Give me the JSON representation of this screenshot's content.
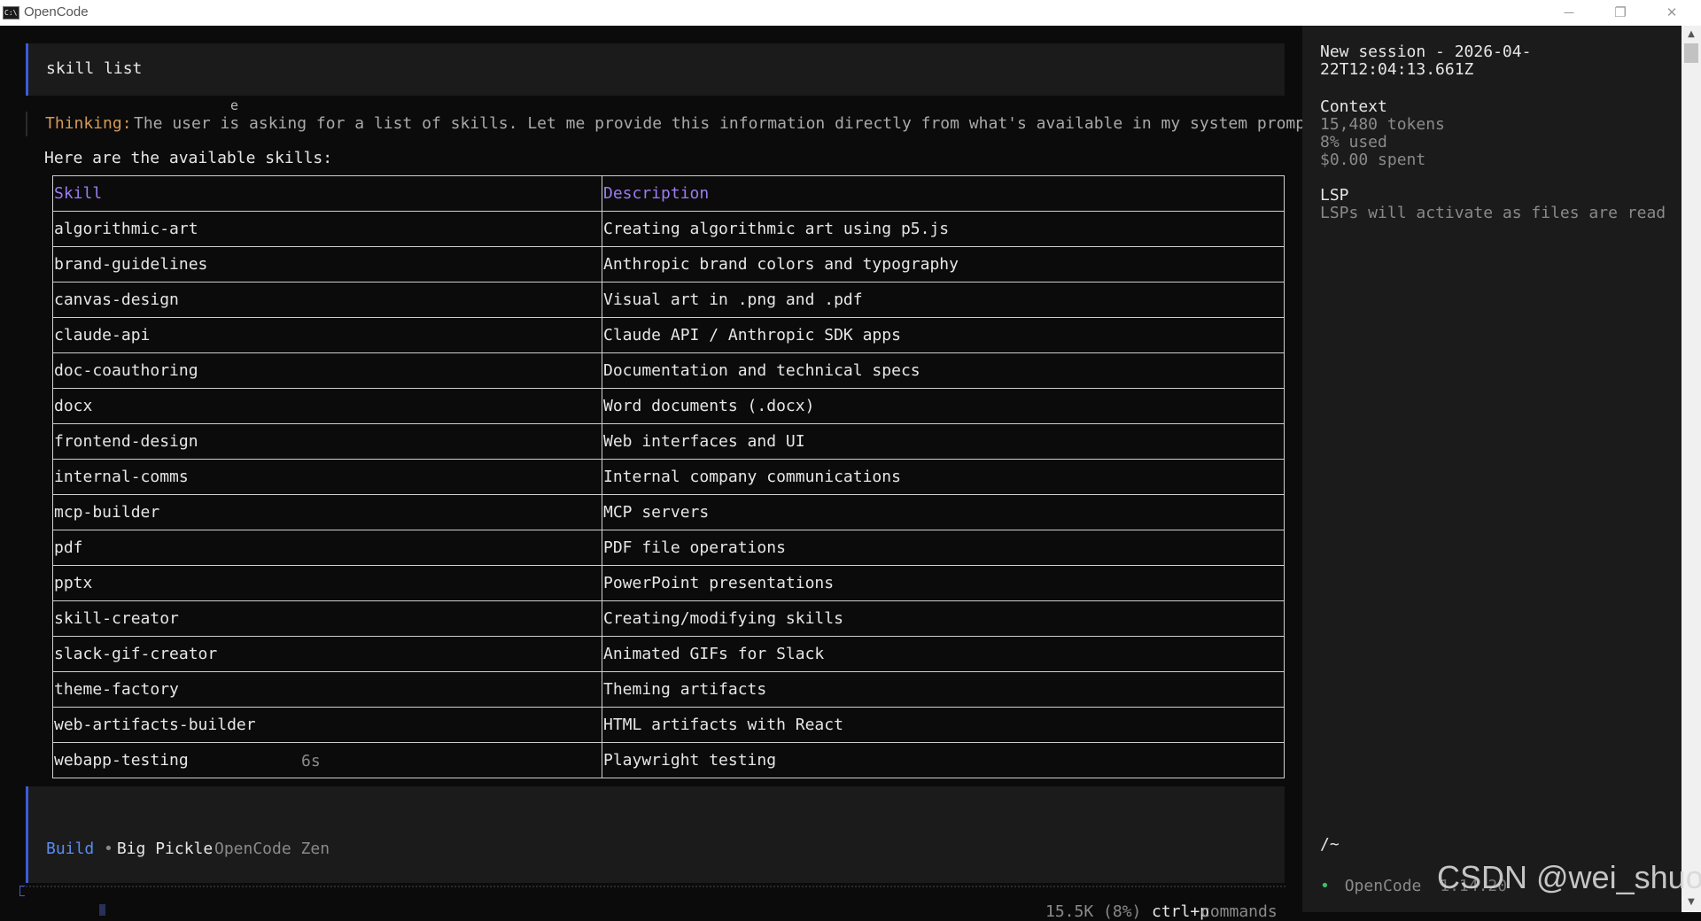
{
  "window": {
    "title": "OpenCode",
    "icon_text": "C:\\",
    "minimize_glyph": "─",
    "maximize_glyph": "❐",
    "close_glyph": "✕"
  },
  "conversation": {
    "user_message": "skill list",
    "stray_char": "e",
    "thinking_label": "Thinking:",
    "thinking_text": "The user is asking for a list of skills. Let me provide this information directly from what's available in my system prompt.",
    "intro": "Here are the available skills:",
    "table": {
      "headers": [
        "Skill",
        "Description"
      ],
      "rows": [
        [
          "algorithmic-art",
          "Creating algorithmic art using p5.js"
        ],
        [
          "brand-guidelines",
          "Anthropic brand colors and typography"
        ],
        [
          "canvas-design",
          "Visual art in .png and .pdf"
        ],
        [
          "claude-api",
          "Claude API / Anthropic SDK apps"
        ],
        [
          "doc-coauthoring",
          "Documentation and technical specs"
        ],
        [
          "docx",
          "Word documents (.docx)"
        ],
        [
          "frontend-design",
          "Web interfaces and UI"
        ],
        [
          "internal-comms",
          "Internal company communications"
        ],
        [
          "mcp-builder",
          "MCP servers"
        ],
        [
          "pdf",
          "PDF file operations"
        ],
        [
          "pptx",
          "PowerPoint presentations"
        ],
        [
          "skill-creator",
          "Creating/modifying skills"
        ],
        [
          "slack-gif-creator",
          "Animated GIFs for Slack"
        ],
        [
          "theme-factory",
          "Theming artifacts"
        ],
        [
          "web-artifacts-builder",
          "HTML artifacts with React"
        ],
        [
          "webapp-testing",
          "Playwright testing"
        ]
      ]
    },
    "duration": "6s"
  },
  "prompt": {
    "agent": "Build",
    "model_dot": "•",
    "model": "Big Pickle",
    "provider": "OpenCode Zen"
  },
  "status": {
    "tokens": "15.5K (8%)",
    "shortcut_key": "ctrl+p",
    "shortcut_label": "commands"
  },
  "sidebar": {
    "session_title": "New session - 2026-04-22T12:04:13.661Z",
    "context_heading": "Context",
    "context_tokens": "15,480 tokens",
    "context_used": "8% used",
    "context_spent": "$0.00 spent",
    "lsp_heading": "LSP",
    "lsp_text": "LSPs will activate as files are read",
    "cwd": "/~",
    "version_dot": "•",
    "version_name": "OpenCode",
    "version_number": "1.14.20"
  },
  "watermark": "CSDN @wei_shuo",
  "colors": {
    "accent_blue": "#3c5dd6",
    "thinking_orange": "#d49a57",
    "header_purple": "#9b7cf0",
    "status_green": "#3fbf6a"
  }
}
